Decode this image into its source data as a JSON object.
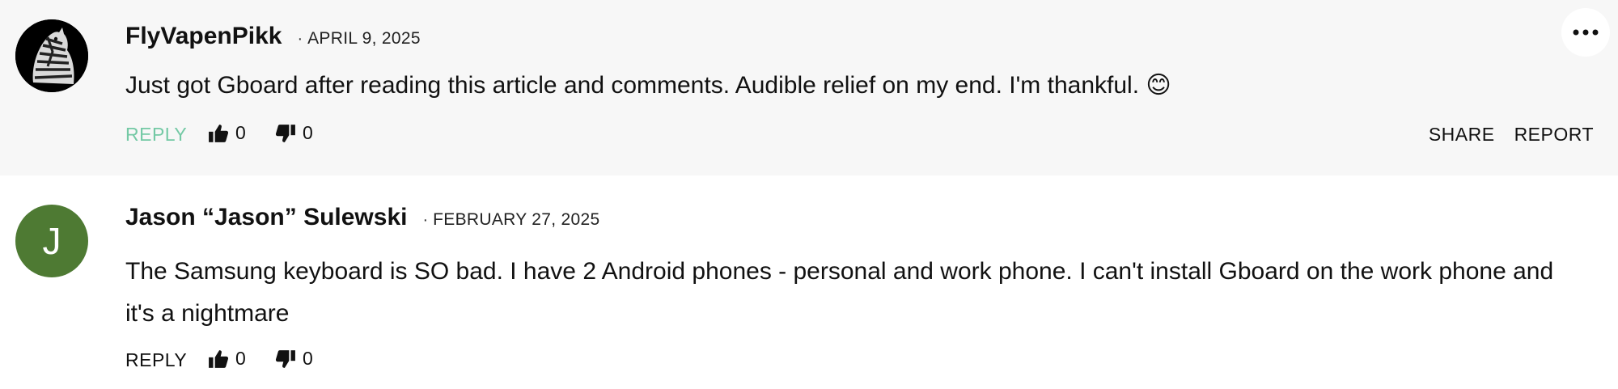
{
  "comments": [
    {
      "author": "FlyVapenPikk",
      "separator": "·",
      "date": "APRIL 9, 2025",
      "text": "Just got Gboard after reading this article and comments. Audible relief on my end. I'm thankful. 😊",
      "reply_label": "REPLY",
      "likes": "0",
      "dislikes": "0",
      "share_label": "SHARE",
      "report_label": "REPORT",
      "reply_color": "#74c9a5"
    },
    {
      "author": "Jason “Jason” Sulewski",
      "avatar_letter": "J",
      "avatar_color": "#4e7a33",
      "separator": "·",
      "date": "FEBRUARY 27, 2025",
      "text": "The Samsung keyboard is SO bad. I have 2 Android phones - personal and work phone. I can't install Gboard on the work phone and it's a nightmare",
      "reply_label": "REPLY",
      "likes": "0",
      "dislikes": "0"
    }
  ],
  "icons": {
    "more": "more-options-icon",
    "like": "thumbs-up-icon",
    "dislike": "thumbs-down-icon",
    "avatar_image": "zebra-avatar"
  }
}
